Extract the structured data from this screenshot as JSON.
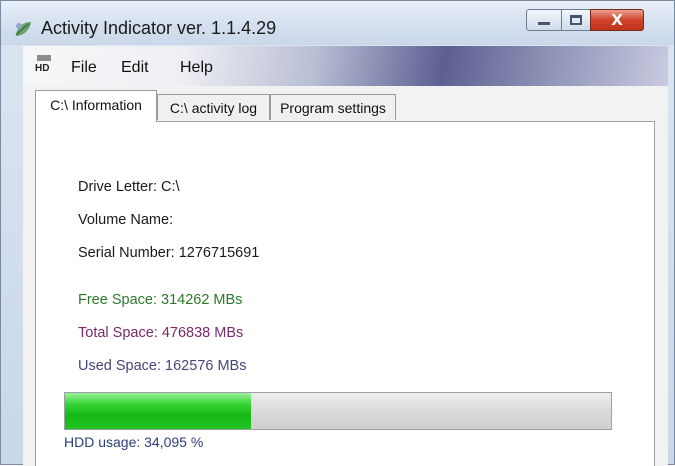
{
  "window": {
    "title": "Activity Indicator ver. 1.1.4.29",
    "close_label": "X"
  },
  "menu": {
    "icon_label": "HD",
    "items": [
      "File",
      "Edit",
      "Help"
    ]
  },
  "tabs": [
    {
      "label": "C:\\ Information",
      "active": true
    },
    {
      "label": "C:\\ activity log",
      "active": false
    },
    {
      "label": "Program settings",
      "active": false
    }
  ],
  "info": {
    "drive_letter": "Drive Letter: C:\\",
    "volume_name": "Volume Name:",
    "serial_number": "Serial Number: 1276715691",
    "free_space": "Free Space: 314262 MBs",
    "total_space": "Total Space: 476838 MBs",
    "used_space": "Used Space: 162576 MBs"
  },
  "usage": {
    "percent": 34.095,
    "label": "HDD usage:  34,095 %"
  },
  "colors": {
    "free": "#2b7a2b",
    "total": "#7a2a6a",
    "used": "#46467a",
    "progress": "#22c422"
  }
}
